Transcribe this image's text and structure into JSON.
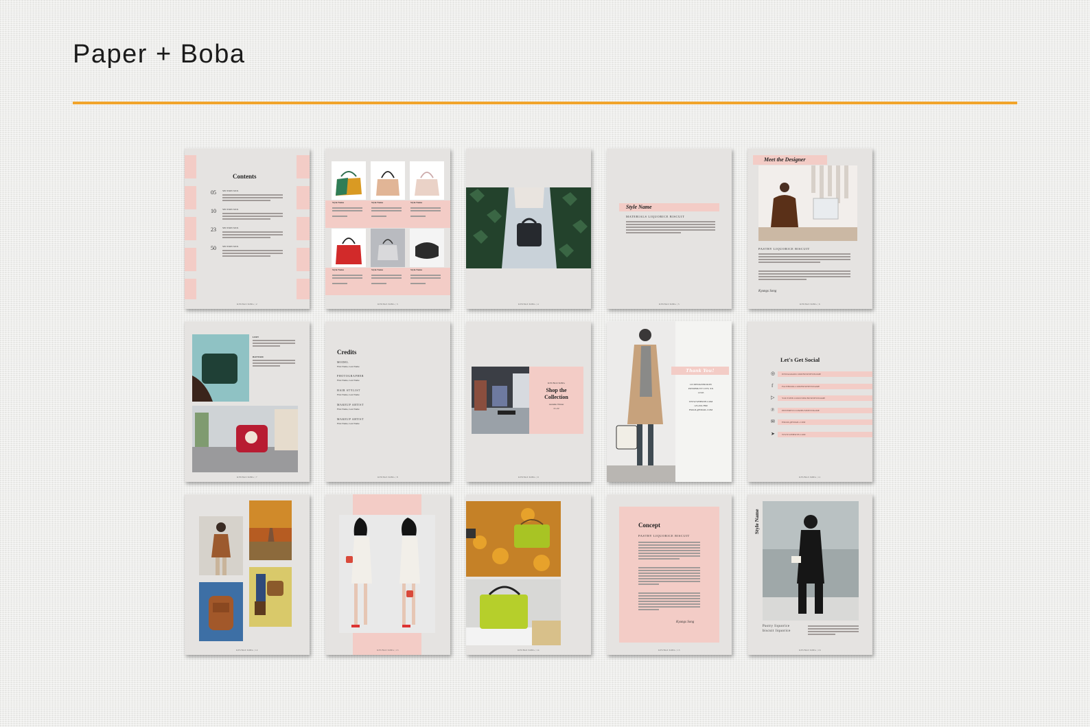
{
  "header": {
    "brand": "Paper + Boba",
    "accent": "#f1a42b"
  },
  "pages": {
    "contents": {
      "title": "Contents",
      "entries": [
        {
          "num": "05",
          "label": "SECTION XXX"
        },
        {
          "num": "10",
          "label": "SECTION XXX"
        },
        {
          "num": "23",
          "label": "SECTION XXX"
        },
        {
          "num": "50",
          "label": "SECTION XXX"
        }
      ]
    },
    "products": {
      "style_name": "Style Name"
    },
    "style": {
      "title": "Style Name",
      "subtitle": "MATERIALS LIQUORICE BISCUIT"
    },
    "designer": {
      "title": "Meet the Designer",
      "subtitle": "PASTRY LIQUORICE BISCUIT",
      "signature": "Kyungs Song"
    },
    "detail": {
      "label_left": "LEFT",
      "label_bottom": "BOTTOM"
    },
    "credits": {
      "title": "Credits",
      "roles": [
        {
          "role": "MODEL",
          "name": "First Name, Last Name"
        },
        {
          "role": "PHOTOGRAPHER",
          "name": "First Name, Last Name"
        },
        {
          "role": "HAIR STYLIST",
          "name": "First Name, Last Name"
        },
        {
          "role": "MAKEUP ARTIST",
          "name": "First Name, Last Name"
        },
        {
          "role": "MAKEUP ARTIST",
          "name": "First Name, Last Name"
        }
      ]
    },
    "shop": {
      "brand_small": "KYUNGS SONG",
      "title_line1": "Shop the",
      "title_line2": "Collection",
      "season": "Autumn Winter",
      "year": "21-22"
    },
    "thanks": {
      "title": "Thank You!",
      "address1": "123 DESIGNER ROW",
      "address2": "POSSIBILITY CITY, XX",
      "address3": "12345",
      "website": "WWW.WEBSITE.COM",
      "phone": "123-456-7890",
      "email": "EMAIL@EMAIL.COM"
    },
    "social": {
      "title": "Let's Get Social",
      "links": [
        {
          "icon": "instagram-icon",
          "text": "INSTAGRAM.COM/BUSINESSNAME"
        },
        {
          "icon": "facebook-icon",
          "text": "FACEBOOK.COM/BUSINESSNAME"
        },
        {
          "icon": "youtube-icon",
          "text": "YOUTUBE.COM/USER/BUSINESSNAME"
        },
        {
          "icon": "pinterest-icon",
          "text": "PINTEREST.COM/BUSINESSNAME"
        },
        {
          "icon": "email-icon",
          "text": "EMAIL@EMAIL.COM"
        },
        {
          "icon": "cursor-icon",
          "text": "WWW.WEBSITE.COM"
        }
      ]
    },
    "concept": {
      "title": "Concept",
      "subtitle": "PASTRY LIQUORICE BISCUIT",
      "signature": "Kyungs Song"
    },
    "lookbook": {
      "side_title": "Style Name",
      "caption1": "Pastry liquorice",
      "caption2": "biscuit liquorice"
    }
  },
  "colors": {
    "page_bg": "#e5e3e1",
    "pink": "#f3ccc6"
  }
}
